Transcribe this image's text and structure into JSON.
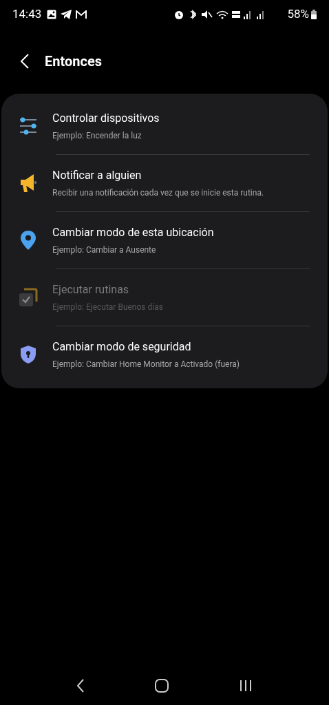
{
  "status_bar": {
    "time": "14:43",
    "battery": "58%"
  },
  "header": {
    "title": "Entonces"
  },
  "items": [
    {
      "kind": "sliders",
      "title": "Controlar dispositivos",
      "subtitle": "Ejemplo: Encender la luz",
      "disabled": false
    },
    {
      "kind": "megaphone",
      "title": "Notificar a alguien",
      "subtitle": "Recibir una notificación cada vez que se inicie esta rutina.",
      "disabled": false
    },
    {
      "kind": "pin",
      "title": "Cambiar modo de esta ubicación",
      "subtitle": "Ejemplo: Cambiar a Ausente",
      "disabled": false
    },
    {
      "kind": "routines",
      "title": "Ejecutar rutinas",
      "subtitle": "Ejemplo: Ejecutar Buenos días",
      "disabled": true
    },
    {
      "kind": "shield",
      "title": "Cambiar modo de seguridad",
      "subtitle": "Ejemplo: Cambiar Home Monitor a Activado (fuera)",
      "disabled": false
    }
  ]
}
